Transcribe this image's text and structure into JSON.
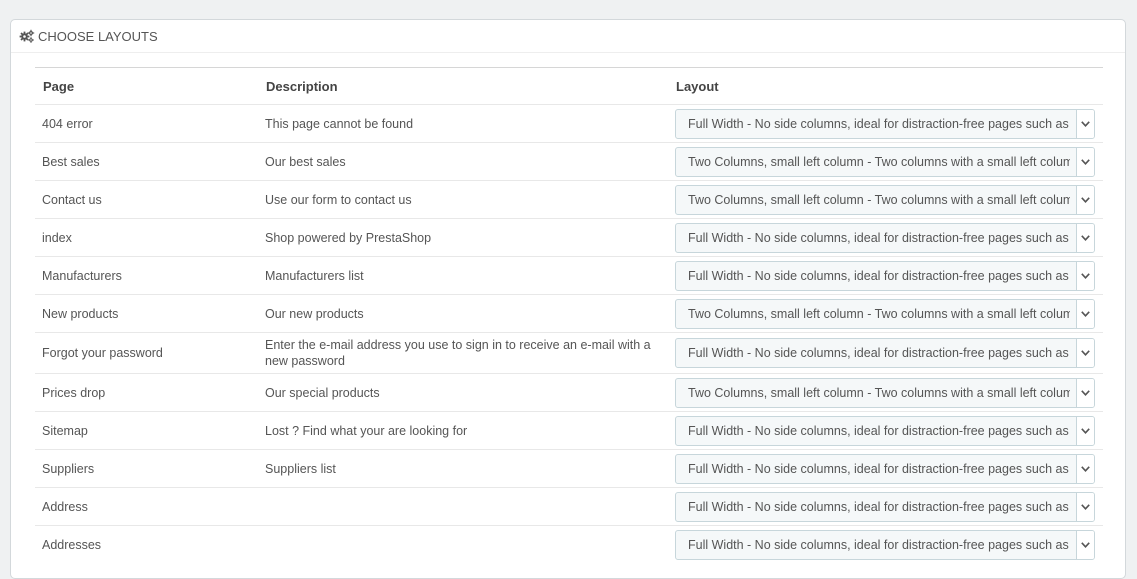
{
  "panel": {
    "title": "CHOOSE LAYOUTS",
    "icon": "cogs-icon"
  },
  "table": {
    "headers": {
      "page": "Page",
      "description": "Description",
      "layout": "Layout"
    },
    "rows": [
      {
        "page": "404 error",
        "description": "This page cannot be found",
        "layout": "Full Width - No side columns, ideal for distraction-free pages such as"
      },
      {
        "page": "Best sales",
        "description": "Our best sales",
        "layout": "Two Columns, small left column - Two columns with a small left colum"
      },
      {
        "page": "Contact us",
        "description": "Use our form to contact us",
        "layout": "Two Columns, small left column - Two columns with a small left colum"
      },
      {
        "page": "index",
        "description": "Shop powered by PrestaShop",
        "layout": "Full Width - No side columns, ideal for distraction-free pages such as"
      },
      {
        "page": "Manufacturers",
        "description": "Manufacturers list",
        "layout": "Full Width - No side columns, ideal for distraction-free pages such as"
      },
      {
        "page": "New products",
        "description": "Our new products",
        "layout": "Two Columns, small left column - Two columns with a small left colum"
      },
      {
        "page": "Forgot your password",
        "description": "Enter the e-mail address you use to sign in to receive an e-mail with a new password",
        "layout": "Full Width - No side columns, ideal for distraction-free pages such as"
      },
      {
        "page": "Prices drop",
        "description": "Our special products",
        "layout": "Two Columns, small left column - Two columns with a small left colum"
      },
      {
        "page": "Sitemap",
        "description": "Lost ? Find what your are looking for",
        "layout": "Full Width - No side columns, ideal for distraction-free pages such as"
      },
      {
        "page": "Suppliers",
        "description": "Suppliers list",
        "layout": "Full Width - No side columns, ideal for distraction-free pages such as"
      },
      {
        "page": "Address",
        "description": "",
        "layout": "Full Width - No side columns, ideal for distraction-free pages such as"
      },
      {
        "page": "Addresses",
        "description": "",
        "layout": "Full Width - No side columns, ideal for distraction-free pages such as"
      }
    ]
  }
}
